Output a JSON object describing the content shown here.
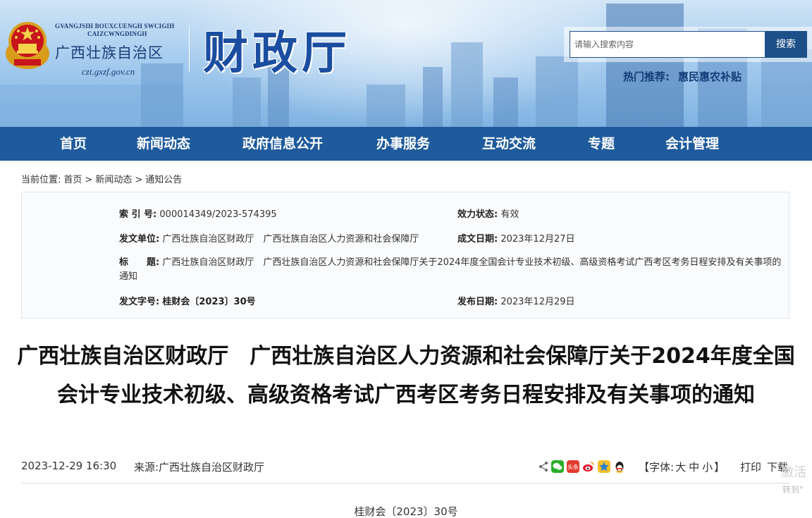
{
  "header": {
    "zhuang_line1": "GVANGJSIH BOUXCUENGH SWCIGIH",
    "zhuang_line2": "CAIZCWNGDINGH",
    "region_name": "广西壮族自治区",
    "site_url": "czt.gxzf.gov.cn",
    "dept_name": "财政厅",
    "search_placeholder": "请输入搜索内容",
    "search_button": "搜索",
    "hot_label": "热门推荐:",
    "hot_link": "惠民惠农补贴"
  },
  "nav": {
    "items": [
      "首页",
      "新闻动态",
      "政府信息公开",
      "办事服务",
      "互动交流",
      "专题",
      "会计管理"
    ]
  },
  "breadcrumb": {
    "label": "当前位置:",
    "home": "首页",
    "sep": ">",
    "news": "新闻动态",
    "current": "通知公告"
  },
  "meta": {
    "index_label": "索  引  号:",
    "index_value": "000014349/2023-574395",
    "status_label": "效力状态:",
    "status_value": "有效",
    "issuer_label": "发文单位:",
    "issuer_value": "广西壮族自治区财政厅　广西壮族自治区人力资源和社会保障厅",
    "created_label": "成文日期:",
    "created_value": "2023年12月27日",
    "title_label": "标　　题:",
    "title_value": "广西壮族自治区财政厅　广西壮族自治区人力资源和社会保障厅关于2024年度全国会计专业技术初级、高级资格考试广西考区考务日程安排及有关事项的通知",
    "docno_label": "发文字号:",
    "docno_value": "桂财会〔2023〕30号",
    "published_label": "发布日期:",
    "published_value": "2023年12月29日"
  },
  "article": {
    "title": "广西壮族自治区财政厅　广西壮族自治区人力资源和社会保障厅关于2024年度全国会计专业技术初级、高级资格考试广西考区考务日程安排及有关事项的通知",
    "datetime": "2023-12-29 16:30",
    "source": "来源:广西壮族自治区财政厅",
    "font_label_open": "【字体:",
    "font_large": "大",
    "font_medium": "中",
    "font_small": "小",
    "font_label_close": "】",
    "print": "打印",
    "download": "下载",
    "doc_number": "桂财会〔2023〕30号"
  },
  "share_icons": [
    "share-icon",
    "wechat-icon",
    "toutiao-icon",
    "weibo-icon",
    "qzone-icon",
    "qq-icon"
  ],
  "toutiao_label": "头条",
  "colors": {
    "nav_bg": "#1e5a9c",
    "search_button": "#1d4f89",
    "dept_name": "#1b4ea0"
  },
  "overlay": {
    "watermark_line1": "激活",
    "watermark_line2": "转到\""
  }
}
